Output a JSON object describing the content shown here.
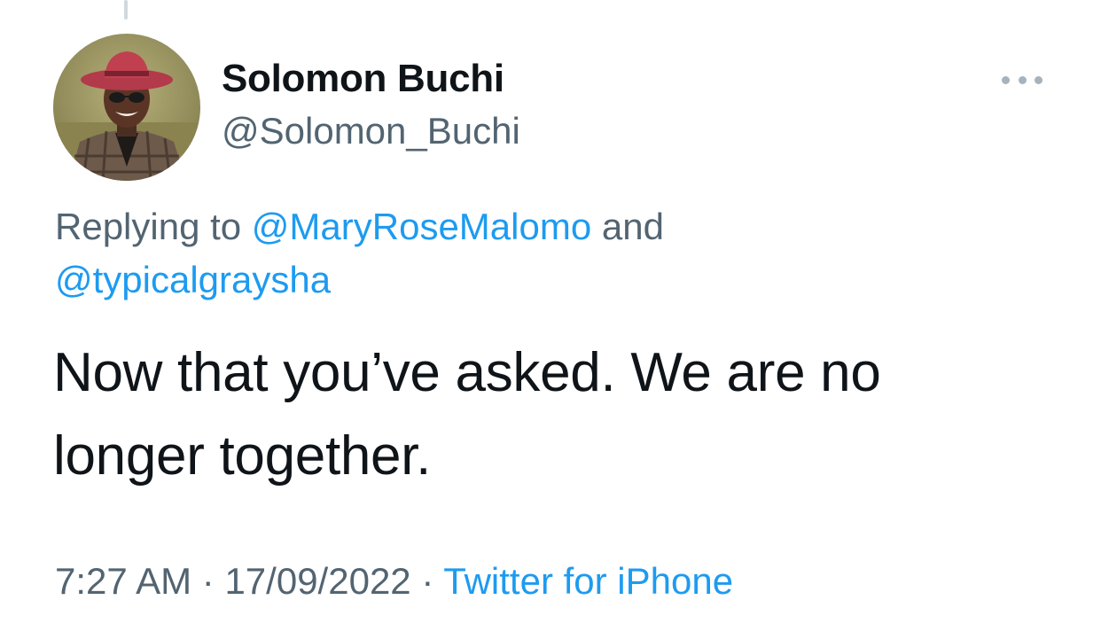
{
  "author": {
    "display_name": "Solomon Buchi",
    "handle": "@Solomon_Buchi"
  },
  "menu": {
    "more_icon": "more-horizontal-icon"
  },
  "reply_context": {
    "prefix": "Replying to",
    "mentions": [
      "@MaryRoseMalomo",
      "@typicalgraysha"
    ],
    "conjunction": "and"
  },
  "tweet": {
    "text": "Now that you’ve asked. We are no longer together."
  },
  "meta": {
    "time": "7:27 AM",
    "separator": "·",
    "date": "17/09/2022",
    "source": "Twitter for iPhone"
  },
  "colors": {
    "link": "#1d9bf0",
    "secondary_text": "#536471",
    "primary_text": "#0f1419"
  }
}
